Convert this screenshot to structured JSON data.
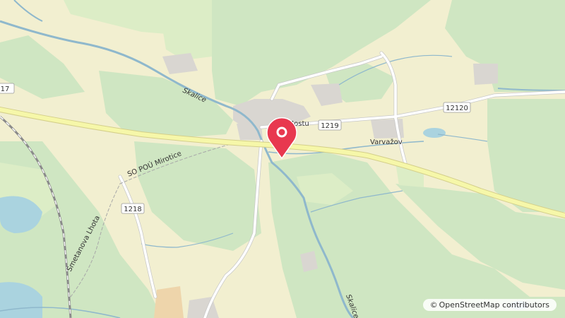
{
  "map": {
    "attribution": {
      "symbol": "©",
      "text": "OpenStreetMap contributors"
    },
    "place_labels": {
      "varvazov": "Varvažov",
      "u_mostu": "U Mostu",
      "smetanova_lhota": "Smetanova Lhota",
      "so_pou_mirotice": "SO POÚ Mirotice",
      "skalice_1": "Skalice",
      "skalice_2": "Skalice"
    },
    "road_labels": {
      "r1219": "1219",
      "r12120": "12120",
      "r1218": "1218",
      "r17": "17"
    },
    "marker": {
      "icon": "map-pin-icon",
      "color": "#e8384f"
    },
    "colors": {
      "forest": "#cfe6c2",
      "meadow": "#dcedc6",
      "water": "#aad3df",
      "river": "#8fb8cc",
      "main_road": "#f6f7a9",
      "road": "#ffffff",
      "built": "#d9d6d1"
    }
  }
}
